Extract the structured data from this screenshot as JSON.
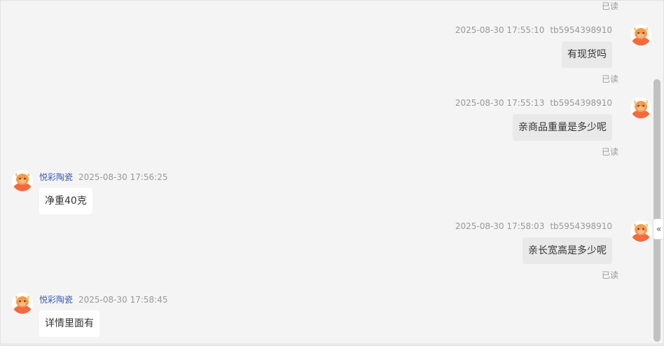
{
  "messages": [
    {
      "id": "m0",
      "direction": "out",
      "read_status": "已读"
    },
    {
      "id": "m1",
      "direction": "out",
      "timestamp": "2025-08-30 17:55:10",
      "sender": "tb5954398910",
      "text": "有现货吗",
      "read_status": "已读"
    },
    {
      "id": "m2",
      "direction": "out",
      "timestamp": "2025-08-30 17:55:13",
      "sender": "tb5954398910",
      "text": "亲商品重量是多少呢",
      "read_status": "已读"
    },
    {
      "id": "m3",
      "direction": "in",
      "sender": "悦彩陶瓷",
      "timestamp": "2025-08-30 17:56:25",
      "text": "净重40克"
    },
    {
      "id": "m4",
      "direction": "out",
      "timestamp": "2025-08-30 17:58:03",
      "sender": "tb5954398910",
      "text": "亲长宽高是多少呢",
      "read_status": "已读"
    },
    {
      "id": "m5",
      "direction": "in",
      "sender": "悦彩陶瓷",
      "timestamp": "2025-08-30 17:58:45",
      "text": "详情里面有"
    }
  ],
  "collapse_toggle": {
    "glyph": "«",
    "icon": "double-chevron-left-icon"
  },
  "avatar_icon": "cartoon-cow-avatar",
  "colors": {
    "background": "#f4f4f4",
    "bubble_out": "#e9e9e9",
    "bubble_in": "#ffffff",
    "nickname": "#3b5bb3",
    "meta": "#999999",
    "scrollbar": "#c1c1c1"
  }
}
